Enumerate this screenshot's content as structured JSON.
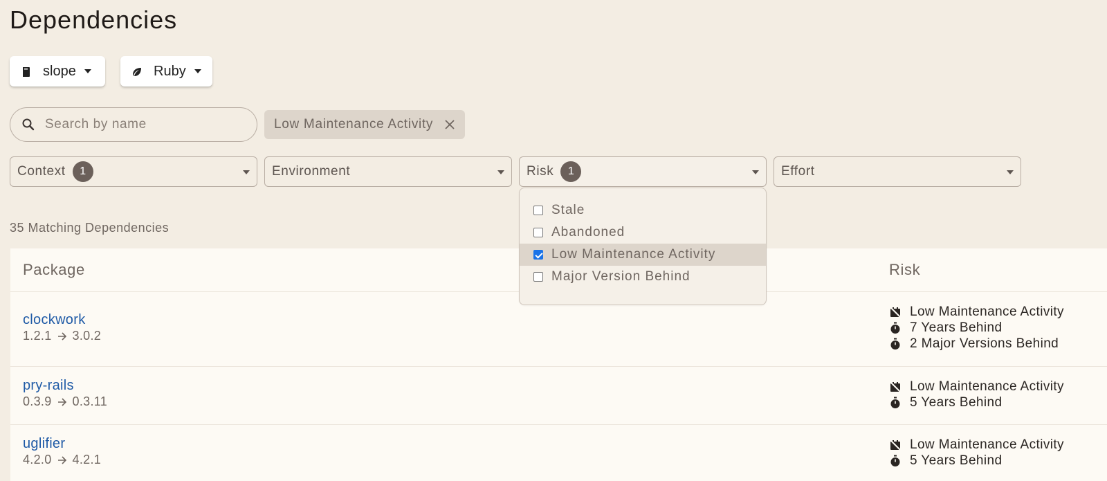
{
  "page": {
    "title": "Dependencies"
  },
  "selectors": {
    "project": {
      "label": "slope",
      "icon": "book-icon"
    },
    "ecosystem": {
      "label": "Ruby",
      "icon": "leaf-icon"
    }
  },
  "search": {
    "placeholder": "Search by name",
    "value": ""
  },
  "active_filters": [
    {
      "label": "Low Maintenance Activity"
    }
  ],
  "filters": [
    {
      "label": "Context",
      "count": "1"
    },
    {
      "label": "Environment",
      "count": ""
    },
    {
      "label": "Risk",
      "count": "1"
    },
    {
      "label": "Effort",
      "count": ""
    }
  ],
  "risk_dropdown": {
    "options": [
      {
        "label": "Stale",
        "checked": false
      },
      {
        "label": "Abandoned",
        "checked": false
      },
      {
        "label": "Low Maintenance Activity",
        "checked": true
      },
      {
        "label": "Major Version Behind",
        "checked": false
      }
    ]
  },
  "results": {
    "count_text": "35 Matching Dependencies"
  },
  "table": {
    "headers": {
      "package": "Package",
      "risk": "Risk"
    },
    "rows": [
      {
        "name": "clockwork",
        "from": "1.2.1",
        "to": "3.0.2",
        "risks": [
          {
            "icon": "calendar-off-icon",
            "text": "Low Maintenance Activity"
          },
          {
            "icon": "stopwatch-icon",
            "text": "7 Years Behind"
          },
          {
            "icon": "stopwatch-icon",
            "text": "2 Major Versions Behind"
          }
        ]
      },
      {
        "name": "pry-rails",
        "from": "0.3.9",
        "to": "0.3.11",
        "risks": [
          {
            "icon": "calendar-off-icon",
            "text": "Low Maintenance Activity"
          },
          {
            "icon": "stopwatch-icon",
            "text": "5 Years Behind"
          }
        ]
      },
      {
        "name": "uglifier",
        "from": "4.2.0",
        "to": "4.2.1",
        "risks": [
          {
            "icon": "calendar-off-icon",
            "text": "Low Maintenance Activity"
          },
          {
            "icon": "stopwatch-icon",
            "text": "5 Years Behind"
          }
        ]
      }
    ]
  },
  "colors": {
    "background": "#f3ede3",
    "link": "#1f5aa6",
    "badge": "#6b605a",
    "checkbox": "#1a73e8"
  }
}
